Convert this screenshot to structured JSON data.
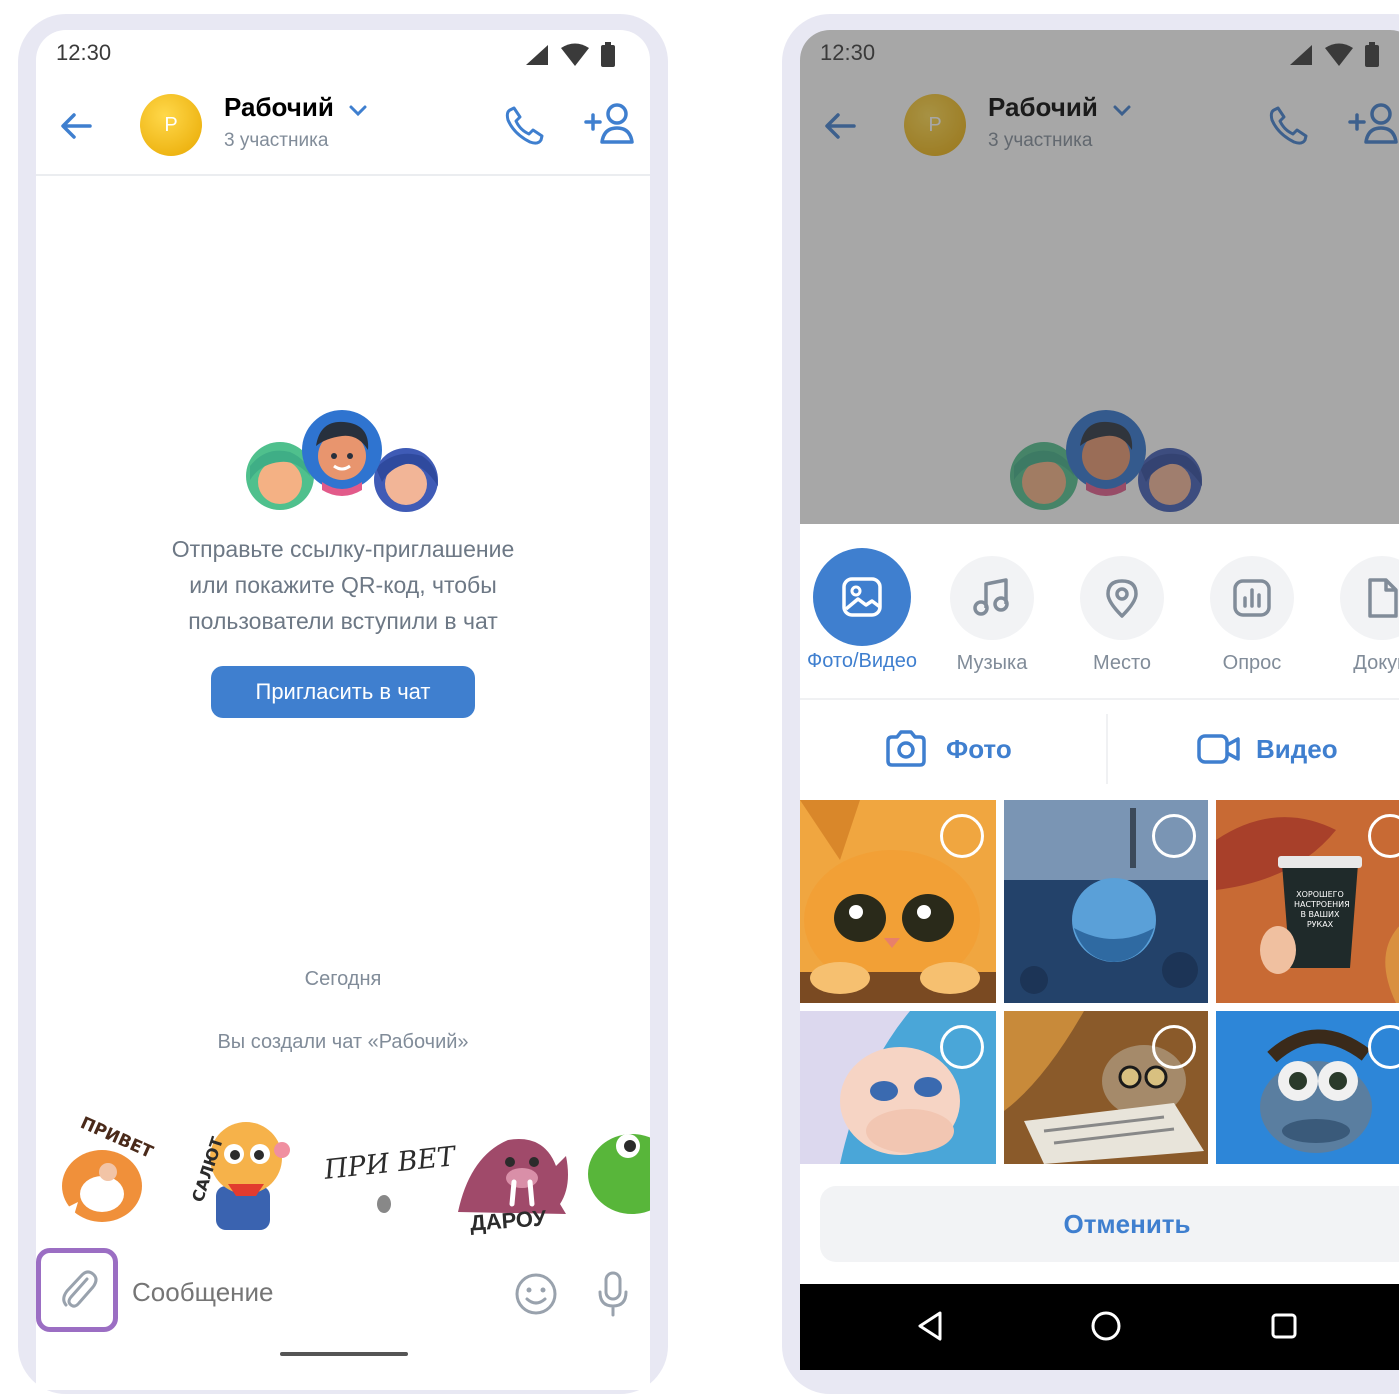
{
  "colors": {
    "accent": "#3f7fcf",
    "avatar": "#f2be1a",
    "highlight": "#9b6ec3",
    "secondary_text": "#818c99"
  },
  "left_phone": {
    "status": {
      "time": "12:30"
    },
    "header": {
      "avatar_letter": "Р",
      "title": "Рабочий",
      "subtitle": "3 участника"
    },
    "empty_state": {
      "line1": "Отправьте ссылку-приглашение",
      "line2": "или покажите QR-код, чтобы",
      "line3": "пользователи вступили в чат",
      "button": "Пригласить в чат"
    },
    "date_label": "Сегодня",
    "system_message": "Вы создали чат «Рабочий»",
    "stickers": [
      {
        "text": "ПРИВЕТ"
      },
      {
        "text": "САЛЮТ"
      },
      {
        "text": "ПРИ ВЕТ"
      },
      {
        "text": "ДАРОУ"
      },
      {
        "text": ""
      }
    ],
    "composer": {
      "placeholder": "Сообщение"
    }
  },
  "right_phone": {
    "status": {
      "time": "12:30"
    },
    "header": {
      "avatar_letter": "Р",
      "title": "Рабочий",
      "subtitle": "3 участника"
    },
    "attach_types": [
      {
        "label": "Фото/Видео",
        "icon": "image-icon",
        "active": true
      },
      {
        "label": "Музыка",
        "icon": "music-icon",
        "active": false
      },
      {
        "label": "Место",
        "icon": "location-icon",
        "active": false
      },
      {
        "label": "Опрос",
        "icon": "poll-icon",
        "active": false
      },
      {
        "label": "Докум",
        "icon": "document-icon",
        "active": false
      }
    ],
    "capture": {
      "photo": "Фото",
      "video": "Видео"
    },
    "cancel": "Отменить",
    "coffee_text": "ХОРОШЕГО НАСТРОЕНИЯ В ВАШИХ РУКАХ"
  }
}
